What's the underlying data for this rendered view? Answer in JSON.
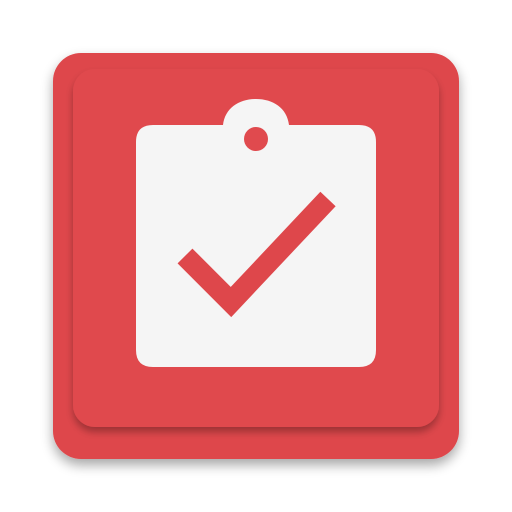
{
  "app_icon": {
    "icon_name": "clipboard-check-icon",
    "colors": {
      "base": "#de474b",
      "base_shadow": "#b8383c",
      "raised": "#e04a4e",
      "clipboard": "#f5f5f5",
      "check": "#de474b"
    }
  }
}
